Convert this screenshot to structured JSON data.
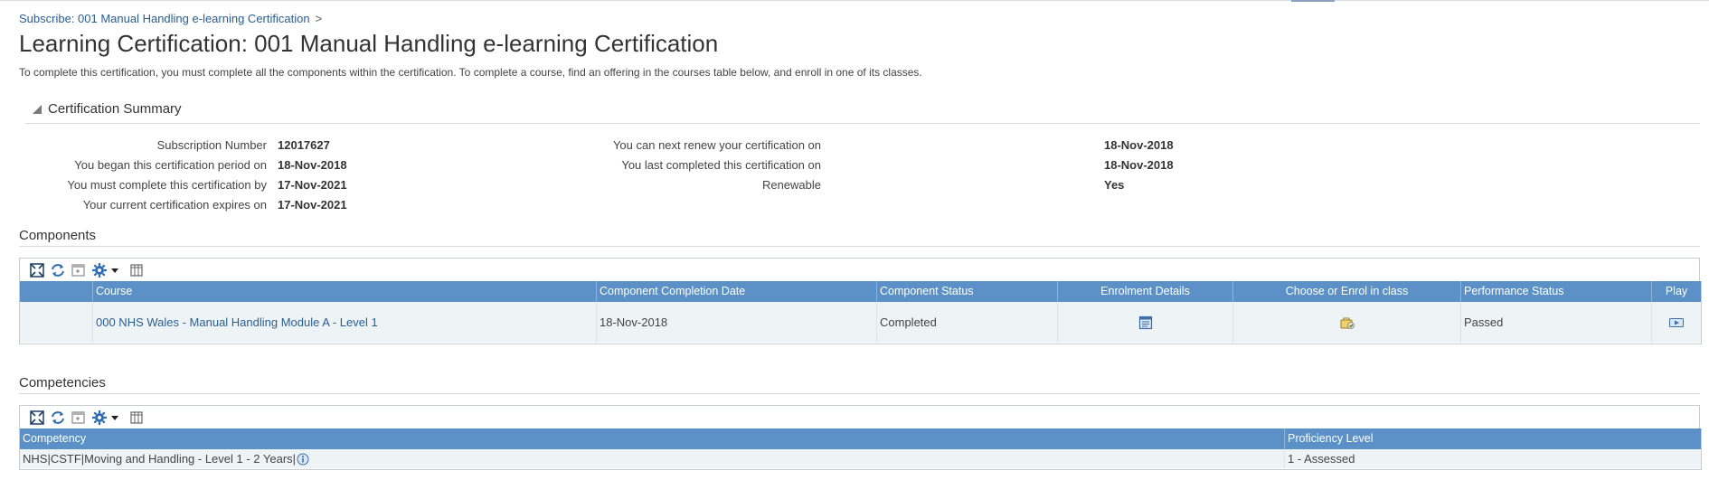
{
  "breadcrumb": {
    "link": "Subscribe: 001 Manual Handling e-learning Certification",
    "separator": ">"
  },
  "page": {
    "title": "Learning Certification: 001 Manual Handling e-learning Certification",
    "description": "To complete this certification, you must complete all the components within the certification. To complete a course, find an offering in the courses table below, and enroll in one of its classes."
  },
  "summary": {
    "title": "Certification Summary",
    "left": [
      {
        "label": "Subscription Number",
        "value": "12017627"
      },
      {
        "label": "You began this certification period on",
        "value": "18-Nov-2018"
      },
      {
        "label": "You must complete this certification by",
        "value": "17-Nov-2021"
      },
      {
        "label": "Your current certification expires on",
        "value": "17-Nov-2021"
      }
    ],
    "right": [
      {
        "label": "You can next renew your certification on",
        "value": "18-Nov-2018"
      },
      {
        "label": "You last completed this certification on",
        "value": "18-Nov-2018"
      },
      {
        "label": "Renewable",
        "value": "Yes"
      }
    ]
  },
  "components": {
    "title": "Components",
    "headers": {
      "course": "Course",
      "completion_date": "Component Completion Date",
      "status": "Component Status",
      "enrolment": "Enrolment Details",
      "choose": "Choose or Enrol in class",
      "performance": "Performance Status",
      "play": "Play"
    },
    "rows": [
      {
        "course": "000 NHS Wales - Manual Handling Module A - Level 1",
        "completion_date": "18-Nov-2018",
        "status": "Completed",
        "performance": "Passed"
      }
    ]
  },
  "competencies": {
    "title": "Competencies",
    "headers": {
      "competency": "Competency",
      "proficiency": "Proficiency Level"
    },
    "rows": [
      {
        "competency": "NHS|CSTF|Moving and Handling - Level 1 - 2 Years|",
        "proficiency": "1 - Assessed"
      }
    ]
  },
  "icons": {
    "toolbar": [
      "detach-icon",
      "refresh-icon",
      "freeze-icon",
      "settings-icon",
      "dropdown-arrow-icon",
      "columns-icon"
    ],
    "enrolment": "enrolment-details-icon",
    "choose": "enrol-class-icon",
    "play": "play-icon",
    "info": "info-icon"
  },
  "colors": {
    "header_bg": "#5b91c6",
    "row_bg": "#eef3f6",
    "link": "#2a5e93",
    "icon_blue": "#3a6ea5"
  }
}
